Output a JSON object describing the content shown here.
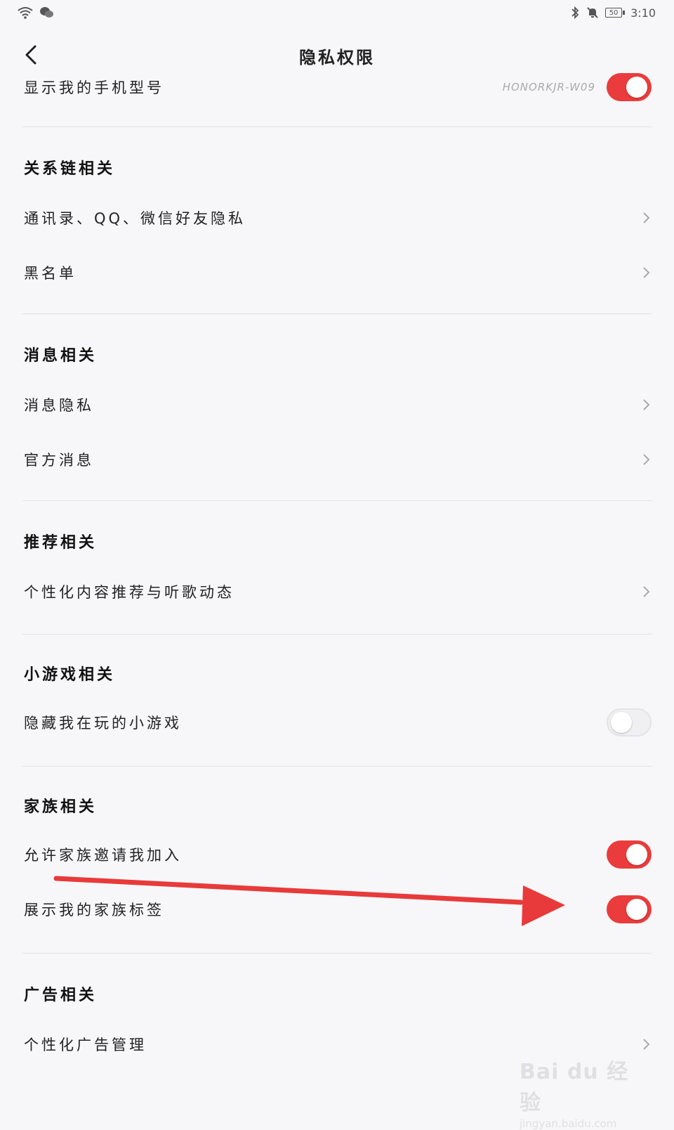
{
  "status": {
    "time": "3:10",
    "battery": "50"
  },
  "header": {
    "title": "隐私权限"
  },
  "top_row": {
    "label": "显示我的手机型号",
    "value": "HONORKJR-W09",
    "toggle": "on"
  },
  "sections": {
    "relations": {
      "title": "关系链相关",
      "items": [
        {
          "label": "通讯录、QQ、微信好友隐私"
        },
        {
          "label": "黑名单"
        }
      ]
    },
    "messages": {
      "title": "消息相关",
      "items": [
        {
          "label": "消息隐私"
        },
        {
          "label": "官方消息"
        }
      ]
    },
    "recommend": {
      "title": "推荐相关",
      "items": [
        {
          "label": "个性化内容推荐与听歌动态"
        }
      ]
    },
    "minigames": {
      "title": "小游戏相关",
      "items": [
        {
          "label": "隐藏我在玩的小游戏",
          "toggle": "off"
        }
      ]
    },
    "family": {
      "title": "家族相关",
      "items": [
        {
          "label": "允许家族邀请我加入",
          "toggle": "on"
        },
        {
          "label": "展示我的家族标签",
          "toggle": "on"
        }
      ]
    },
    "ads": {
      "title": "广告相关",
      "items": [
        {
          "label": "个性化广告管理"
        }
      ]
    }
  },
  "watermark": {
    "main": "Bai du 经验",
    "sub": "jingyan.baidu.com"
  },
  "colors": {
    "accent": "#ea3c3c",
    "annotation_arrow": "#e83a3a"
  }
}
